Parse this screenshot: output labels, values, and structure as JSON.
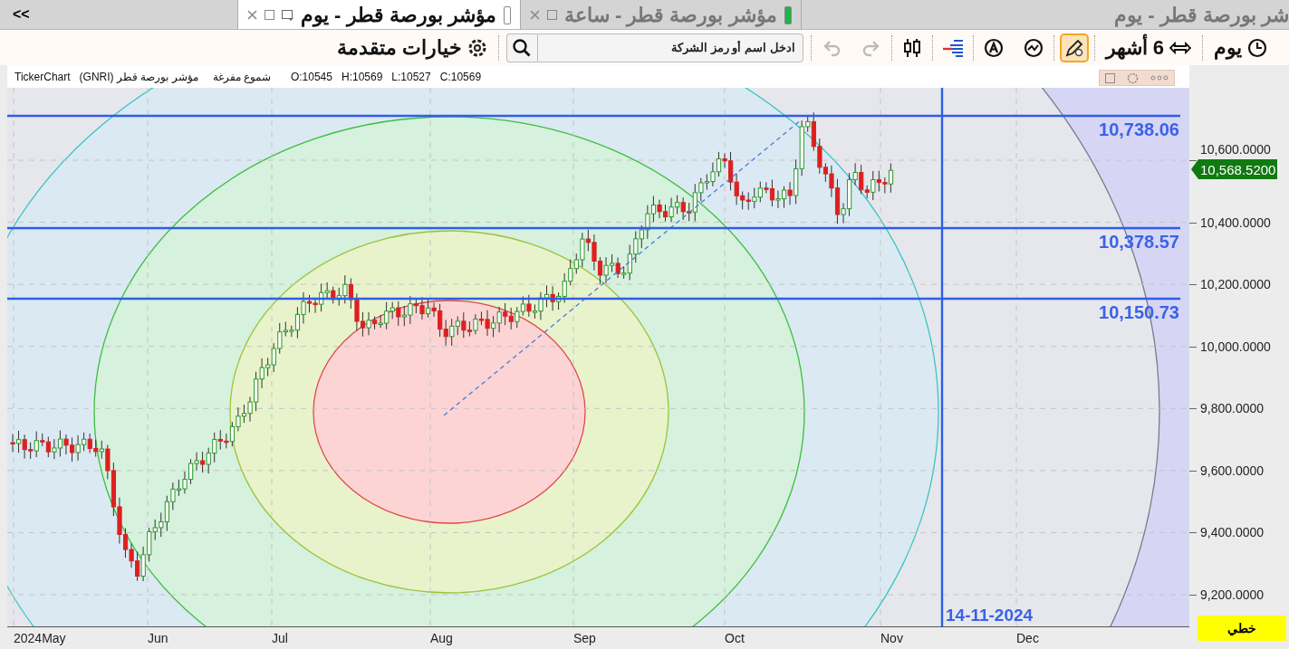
{
  "tabs": {
    "collapse": "<<",
    "items": [
      {
        "title": "شر بورصة قطر - يوم",
        "selected": false
      },
      {
        "title": "مؤشر بورصة قطر - ساعة",
        "selected": false,
        "color": "#22b14c"
      },
      {
        "title": "مؤشر بورصة قطر - يوم",
        "selected": true,
        "color": "#ffffff"
      }
    ]
  },
  "toolbar": {
    "period": "يوم",
    "range": "6 أشهر",
    "draw_mode_on": true,
    "history": [
      {
        "kind": "redo",
        "disabled": true
      },
      {
        "kind": "undo",
        "disabled": true
      }
    ],
    "search": {
      "placeholder": "ادخل اسم أو رمز الشركة"
    },
    "advanced": "خيارات متقدمة"
  },
  "chart": {
    "info": {
      "source": "TickerChart",
      "name": "مؤشر بورصة قطر (GNRI)",
      "style": "شموع مفرغة",
      "ohlc": [
        "O:10545",
        "H:10569",
        "L:10527",
        "C:10569"
      ]
    },
    "levels": [
      "10,738.06",
      "10,378.57",
      "10,150.73"
    ],
    "price_tag": "10,568.5200",
    "y_labels": [
      "10,600.0000",
      "10,400.0000",
      "10,200.0000",
      "10,000.0000",
      "9,800.0000",
      "9,600.0000",
      "9,400.0000",
      "9,200.0000"
    ],
    "x_labels": [
      "2024May",
      "Jun",
      "Jul",
      "Aug",
      "Sep",
      "Oct",
      "Nov",
      "Dec"
    ],
    "date_marker": "14-11-2024",
    "chart_type_button": "خطي"
  }
}
